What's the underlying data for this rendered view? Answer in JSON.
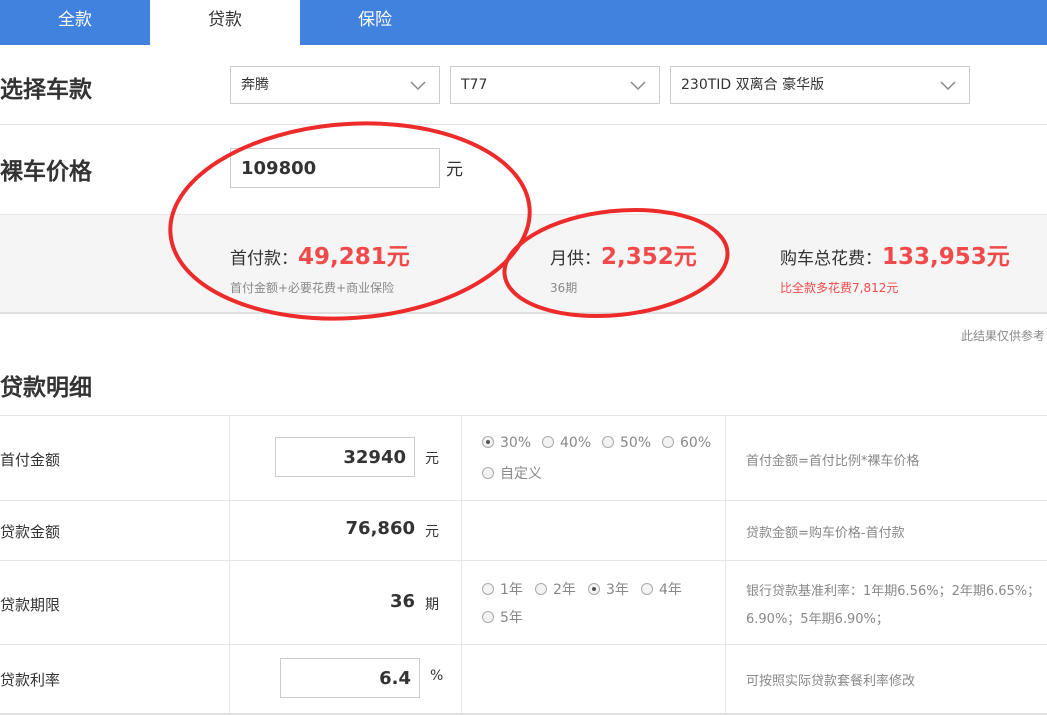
{
  "tabs": [
    {
      "label": "全款",
      "active": false
    },
    {
      "label": "贷款",
      "active": true
    },
    {
      "label": "保险",
      "active": false
    }
  ],
  "select_model": {
    "heading": "选择车款",
    "brand": "奔腾",
    "series": "T77",
    "version": "230TID 双离合 豪华版"
  },
  "price": {
    "heading": "裸车价格",
    "value": "109800",
    "unit": "元"
  },
  "summary": {
    "down_payment_label": "首付款：",
    "down_payment_value": "49,281元",
    "down_payment_note": "首付金额+必要花费+商业保险",
    "monthly_label": "月供：",
    "monthly_value": "2,352元",
    "monthly_note": "36期",
    "total_label": "购车总花费：",
    "total_value": "133,953元",
    "total_note": "比全款多花费7,812元",
    "value_color": "#f24a4a"
  },
  "disclaimer": "此结果仅供参考",
  "loan_detail": {
    "heading": "贷款明细",
    "rows": {
      "down": {
        "label": "首付金额",
        "value": "32940",
        "unit": "元",
        "options": [
          "30%",
          "40%",
          "50%",
          "60%",
          "自定义"
        ],
        "selected": "30%",
        "hint": "首付金额=首付比例*裸车价格"
      },
      "loan": {
        "label": "贷款金额",
        "value": "76,860",
        "unit": "元",
        "hint": "贷款金额=购车价格-首付款"
      },
      "term": {
        "label": "贷款期限",
        "value": "36",
        "unit": "期",
        "options": [
          "1年",
          "2年",
          "3年",
          "4年",
          "5年"
        ],
        "selected": "3年",
        "hint_line1": "银行贷款基准利率：1年期6.56%；2年期6.65%；",
        "hint_line2": "6.90%；5年期6.90%；"
      },
      "rate": {
        "label": "贷款利率",
        "value": "6.4",
        "unit": "%",
        "hint": "可按照实际贷款套餐利率修改"
      }
    }
  },
  "accent_color": "#4182df",
  "icons": [
    "chevron-down-icon",
    "radio-icon"
  ]
}
